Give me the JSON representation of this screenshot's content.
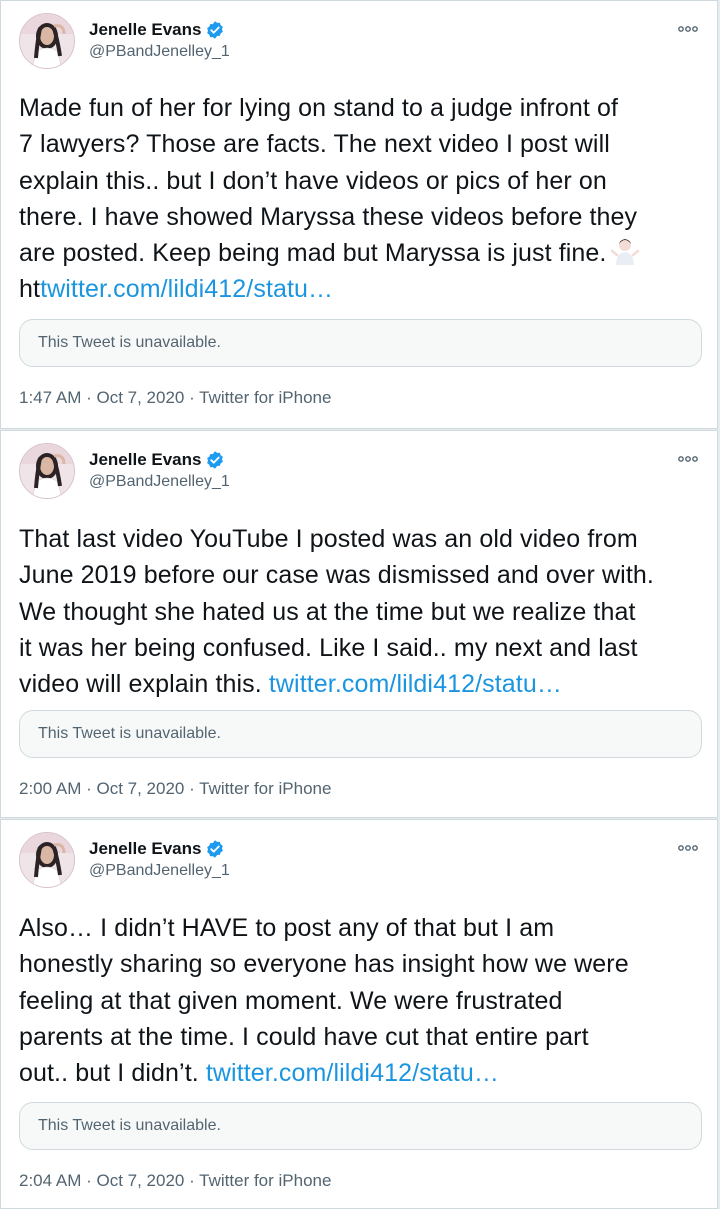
{
  "tweets": [
    {
      "author_name": "Jenelle Evans",
      "author_handle": "@PBandJenelley_1",
      "lines": [
        "Made fun of her for lying on stand to a judge infront of",
        "7 lawyers? Those are facts. The next video I post will",
        "explain this.. but I don’t have videos or pics of her on",
        "there. I have showed Maryssa these videos before they",
        "are posted. Keep being mad but Maryssa is just fine."
      ],
      "link_prefix": "ht",
      "link": "twitter.com/lildi412/statu…",
      "quoted": "This Tweet is unavailable.",
      "meta": "1:47 AM · Oct 7, 2020 · Twitter for iPhone"
    },
    {
      "author_name": "Jenelle Evans",
      "author_handle": "@PBandJenelley_1",
      "lines": [
        "That last video YouTube I posted was an old video from",
        "June 2019 before our case was dismissed and over with.",
        "We thought she hated us at the time but we realize that",
        "it was her being confused. Like I said.. my next and last"
      ],
      "last_line_text": "video will explain this.",
      "link": "twitter.com/lildi412/statu…",
      "quoted": "This Tweet is unavailable.",
      "meta": "2:00 AM · Oct 7, 2020 · Twitter for iPhone"
    },
    {
      "author_name": "Jenelle Evans",
      "author_handle": "@PBandJenelley_1",
      "lines": [
        "Also… I didn’t HAVE to post any of that but I am",
        "honestly sharing so everyone has insight how we were",
        "feeling at that given moment. We were frustrated",
        "parents at the time. I could have cut that entire part"
      ],
      "last_line_text": "out.. but I didn’t.",
      "link": "twitter.com/lildi412/statu…",
      "quoted": "This Tweet is unavailable.",
      "meta": "2:04 AM · Oct 7, 2020 · Twitter for iPhone"
    }
  ],
  "icons": {
    "verified": "verified-badge-icon",
    "more": "more-options-icon",
    "emoji": "woman-shrugging-emoji"
  },
  "colors": {
    "link": "#1b95e0",
    "verified": "#1d9bf0",
    "muted": "#536471"
  }
}
